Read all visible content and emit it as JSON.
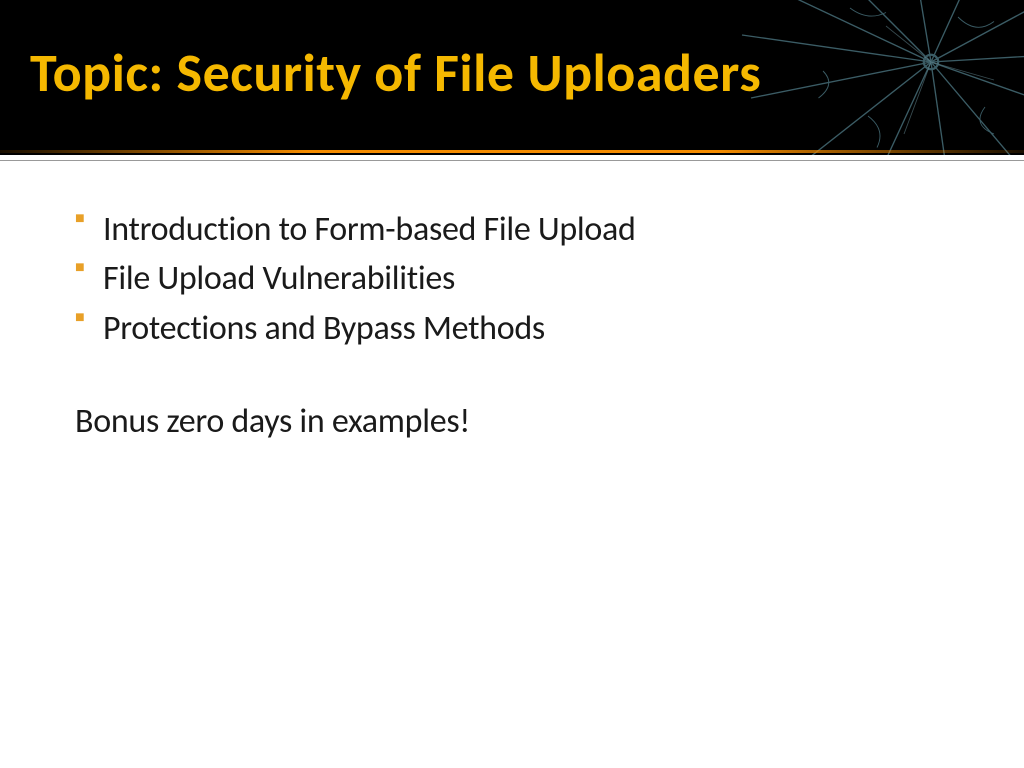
{
  "title": "Topic: Security of File Uploaders",
  "bullets": [
    "Introduction to Form-based File Upload",
    "File Upload Vulnerabilities",
    "Protections and Bypass Methods"
  ],
  "bonus": "Bonus zero days in examples!"
}
